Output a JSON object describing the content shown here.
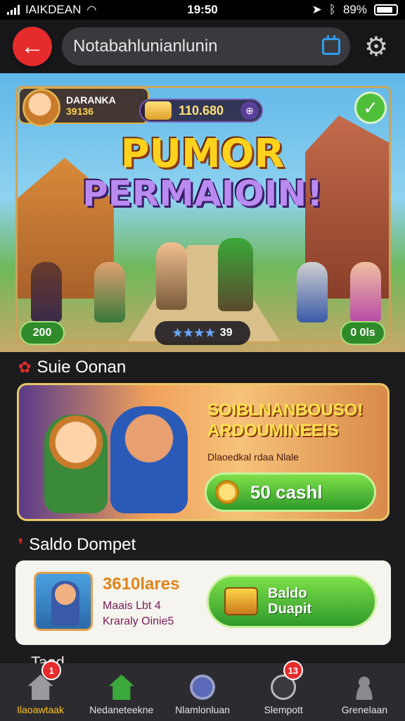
{
  "status_bar": {
    "carrier": "IAIKDEAN",
    "time": "19:50",
    "battery_text": "89%"
  },
  "topbar": {
    "url_text": "Notabahlunianlunin",
    "back_icon": "arrow-left-icon",
    "settings_icon": "gear-icon",
    "calendar_icon": "calendar-icon"
  },
  "hero": {
    "player_name": "DARANKA",
    "player_score": "39136",
    "coin_amount": "110.680",
    "title_line1": "PUMOR",
    "title_line2": "PERMAIOIN!",
    "pill_left": "200",
    "pill_mid_stars": "★★★★",
    "pill_mid_value": "39",
    "pill_right": "0 0ls"
  },
  "promo": {
    "section_title": "Suie Oonan",
    "headline_line1": "SOIBLNANBOUSO!",
    "headline_line2": "ARDOUMINEEIS",
    "subtext": "Dlaoedkal rdaa Nlale",
    "cash_button": "50 cashl"
  },
  "wallet": {
    "section_title": "Saldo Dompet",
    "amount": "3610lares",
    "line1": "Maais Lbt 4",
    "line2": "Kraraly Oinie5",
    "button_line1": "Baldo",
    "button_line2": "Duapit"
  },
  "peek": {
    "text": "Taed"
  },
  "nav": {
    "items": [
      {
        "label": "Ilaoawtaak",
        "badge": "1"
      },
      {
        "label": "Nedaneteekne",
        "badge": ""
      },
      {
        "label": "Nlamlonluan",
        "badge": ""
      },
      {
        "label": "Slempott",
        "badge": "13"
      },
      {
        "label": "Grenelaan",
        "badge": ""
      }
    ]
  },
  "colors": {
    "accent_red": "#e52b2b",
    "accent_green": "#2f9a2a",
    "accent_gold": "#ffc21a",
    "background": "#1c1c1e"
  }
}
